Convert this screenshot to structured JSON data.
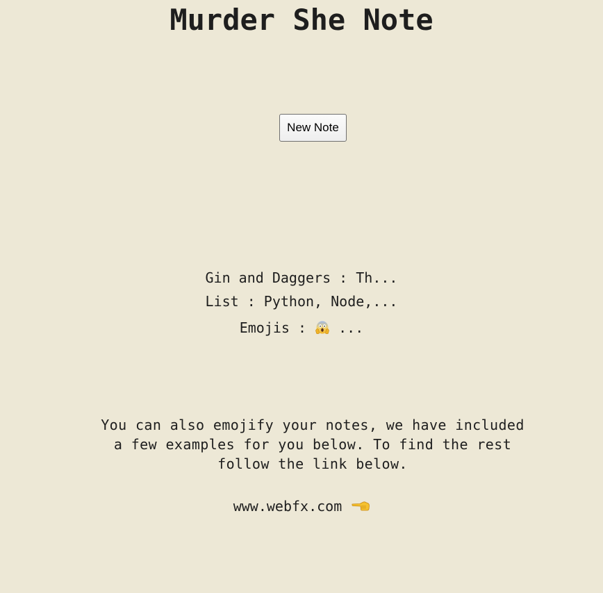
{
  "page": {
    "title": "Murder She Note"
  },
  "toolbar": {
    "new_note_label": "New Note"
  },
  "notes": [
    {
      "label": "Gin and Daggers : Th..."
    },
    {
      "label": "List : Python, Node,..."
    },
    {
      "label_prefix": "Emojis : ",
      "emoji_icon": "face-screaming-in-fear-icon",
      "label_suffix": " ..."
    }
  ],
  "info": {
    "text": "You can also emojify your notes, we have included a few examples for you below. To find the rest follow the link below."
  },
  "link": {
    "text": "www.webfx.com",
    "icon": "backhand-index-pointing-left-icon"
  },
  "colors": {
    "background": "#ede8d6",
    "text": "#1e1e1e"
  }
}
